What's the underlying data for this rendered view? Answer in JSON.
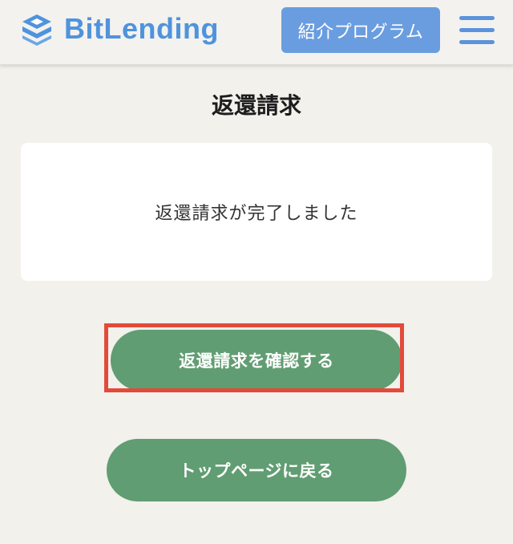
{
  "header": {
    "logo_text": "BitLending",
    "brand_color": "#4f93dd",
    "referral_label": "紹介プログラム",
    "menu_icon": "hamburger-menu-icon"
  },
  "main": {
    "title": "返還請求",
    "message": "返還請求が完了しました",
    "confirm_label": "返還請求を確認する",
    "top_page_label": "トップページに戻る",
    "button_color": "#619d72",
    "highlight_color": "#e34a3a"
  }
}
